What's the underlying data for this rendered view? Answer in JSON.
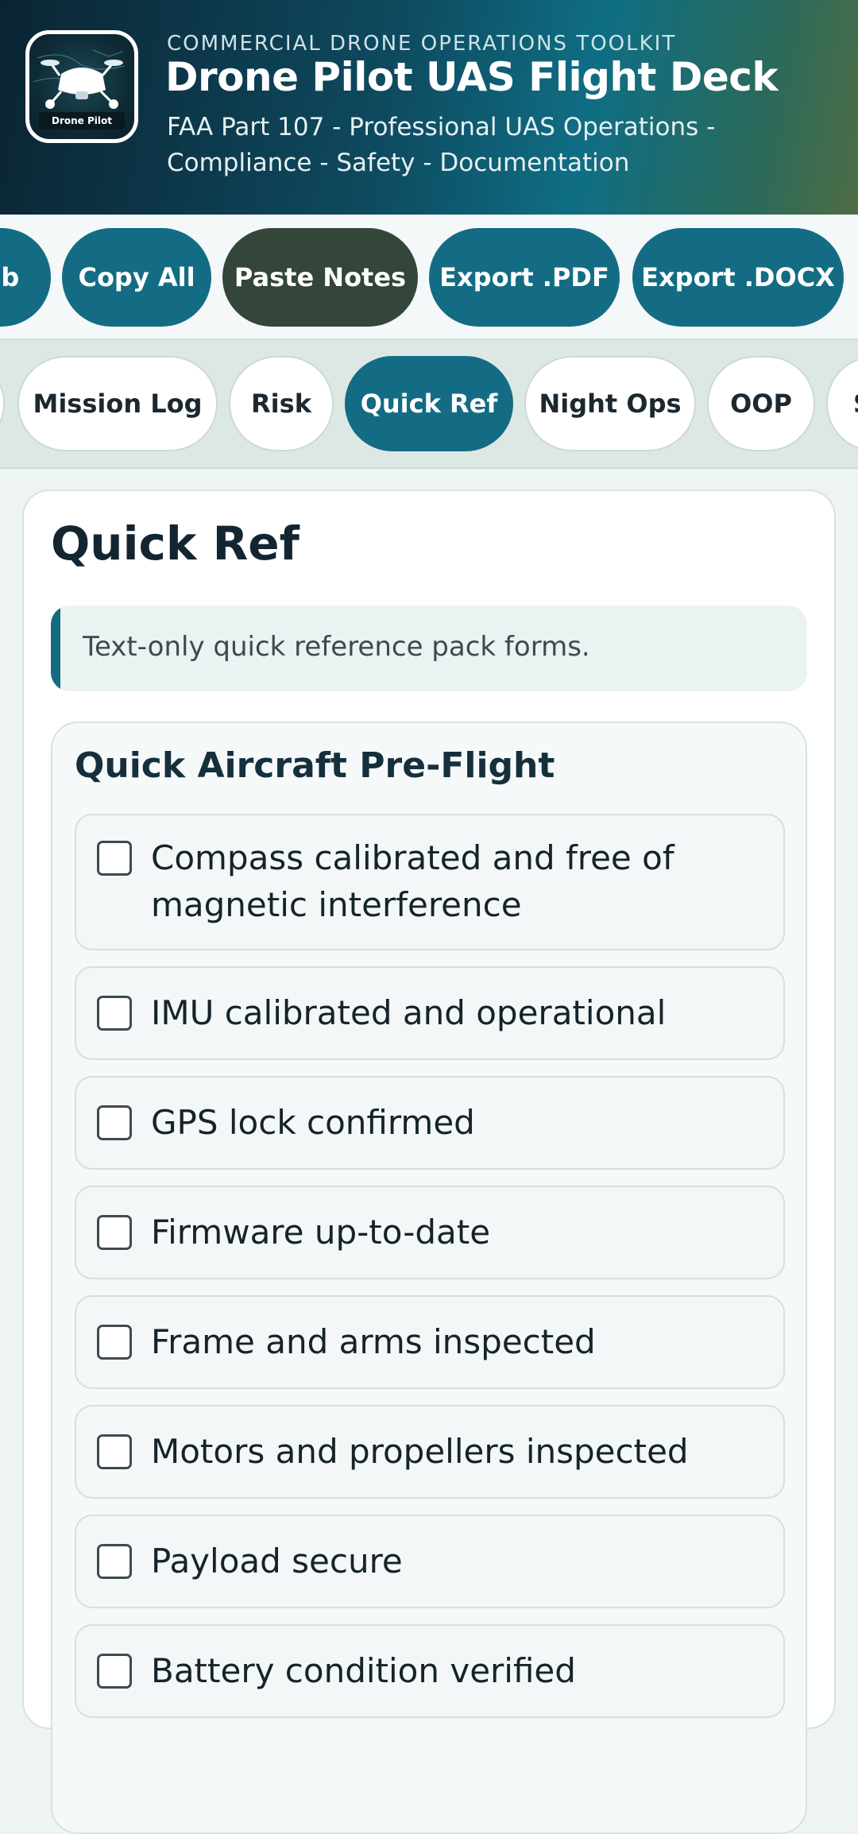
{
  "header": {
    "eyebrow": "COMMERCIAL DRONE OPERATIONS TOOLKIT",
    "title": "Drone Pilot UAS Flight Deck",
    "subtitle": "FAA Part 107 - Professional UAS Operations - Compliance - Safety - Documentation",
    "logo_text": "Drone Pilot",
    "logo_icon": "drone-icon"
  },
  "actions": {
    "items": [
      {
        "label": "ab"
      },
      {
        "label": "Copy All"
      },
      {
        "label": "Paste Notes"
      },
      {
        "label": "Export .PDF"
      },
      {
        "label": "Export .DOCX"
      }
    ]
  },
  "tabs": {
    "items": [
      {
        "label": ""
      },
      {
        "label": "Mission Log"
      },
      {
        "label": "Risk"
      },
      {
        "label": "Quick Ref"
      },
      {
        "label": "Night Ops"
      },
      {
        "label": "OOP"
      },
      {
        "label": "S"
      }
    ],
    "active": "Quick Ref"
  },
  "main": {
    "title": "Quick Ref",
    "note": "Text-only quick reference pack forms.",
    "section": {
      "title": "Quick Aircraft Pre-Flight",
      "items": [
        {
          "label": "Compass calibrated and free of magnetic interference",
          "checked": false
        },
        {
          "label": "IMU calibrated and operational",
          "checked": false
        },
        {
          "label": "GPS lock confirmed",
          "checked": false
        },
        {
          "label": "Firmware up-to-date",
          "checked": false
        },
        {
          "label": "Frame and arms inspected",
          "checked": false
        },
        {
          "label": "Motors and propellers inspected",
          "checked": false
        },
        {
          "label": "Payload secure",
          "checked": false
        },
        {
          "label": "Battery condition verified",
          "checked": false
        }
      ]
    }
  },
  "colors": {
    "accent": "#136c84",
    "dark_button": "#34453a",
    "header_start": "#0b2433",
    "header_end": "#4f6d45"
  }
}
